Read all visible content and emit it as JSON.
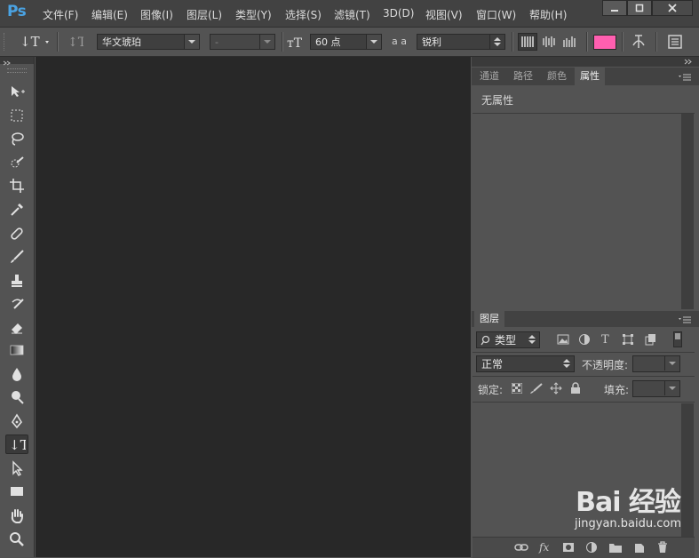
{
  "app": {
    "logo": "Ps"
  },
  "menu": {
    "items": [
      "文件(F)",
      "编辑(E)",
      "图像(I)",
      "图层(L)",
      "类型(Y)",
      "选择(S)",
      "滤镜(T)",
      "3D(D)",
      "视图(V)",
      "窗口(W)",
      "帮助(H)"
    ]
  },
  "options": {
    "font_family": "华文琥珀",
    "font_style": "-",
    "font_size": "60 点",
    "aa_label": "a a",
    "antialias": "锐利",
    "text_color": "#ff5fb0"
  },
  "properties_panel": {
    "tabs": [
      "通道",
      "路径",
      "颜色",
      "属性"
    ],
    "active_tab": "属性",
    "message": "无属性"
  },
  "layers_panel": {
    "tab": "图层",
    "filter_kind": "类型",
    "blend_mode": "正常",
    "opacity_label": "不透明度:",
    "lock_label": "锁定:",
    "fill_label": "填充:"
  },
  "watermark": {
    "logo": "Bai 经验",
    "url": "jingyan.baidu.com"
  },
  "colors": {
    "accent": "#4aa3e3",
    "panel_bg": "#535353",
    "canvas_bg": "#282828",
    "menubar_bg": "#424242",
    "swatch": "#ff5fb0"
  }
}
